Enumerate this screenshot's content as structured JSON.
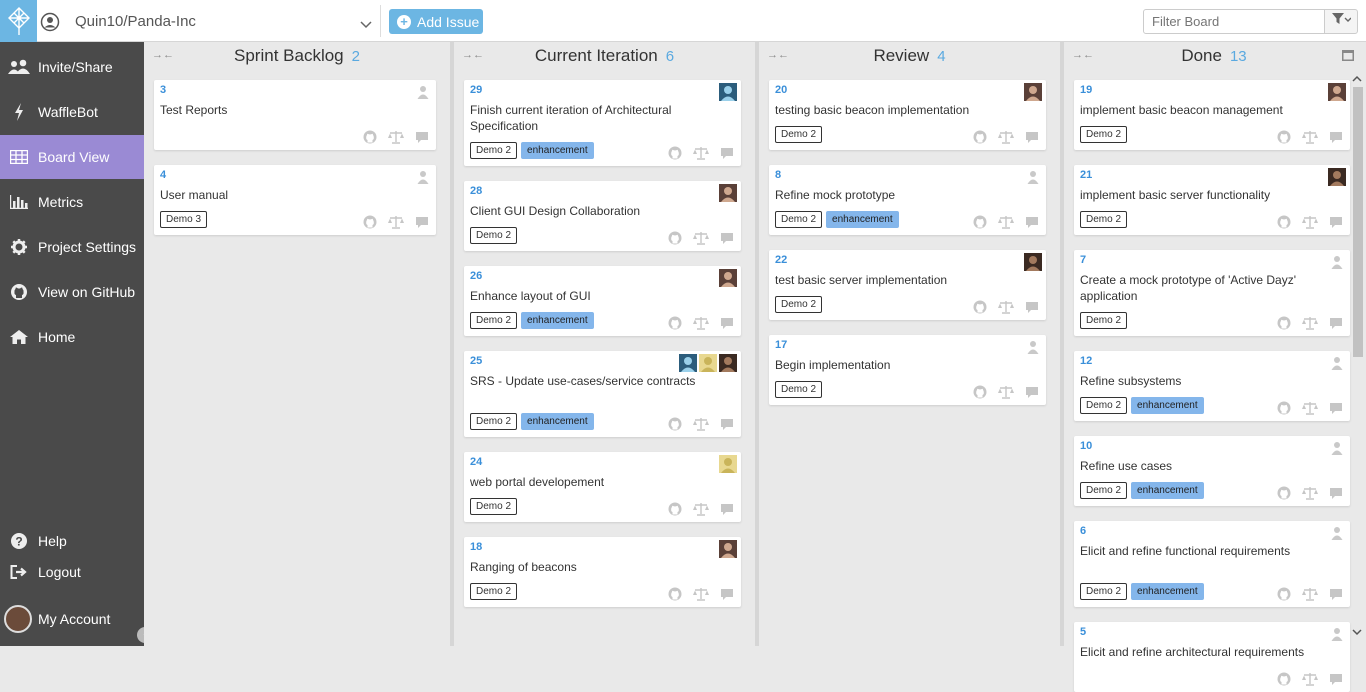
{
  "topbar": {
    "repo": "Quin10/Panda-Inc",
    "add_issue_label": "Add Issue",
    "filter_placeholder": "Filter Board"
  },
  "sidebar": {
    "items": [
      {
        "label": "Invite/Share",
        "icon": "users-icon"
      },
      {
        "label": "WaffleBot",
        "icon": "bolt-icon"
      },
      {
        "label": "Board View",
        "icon": "grid-icon",
        "active": true
      },
      {
        "label": "Metrics",
        "icon": "bar-chart-icon"
      },
      {
        "label": "Project Settings",
        "icon": "gear-icon"
      },
      {
        "label": "View on GitHub",
        "icon": "github-icon"
      },
      {
        "label": "Home",
        "icon": "home-icon"
      }
    ],
    "help_label": "Help",
    "logout_label": "Logout",
    "account_label": "My Account"
  },
  "colors": {
    "accent": "#6cb6e3",
    "active_nav": "#9a8ad4",
    "enhancement": "#84b6eb",
    "sidebar": "#4a4a4a"
  },
  "columns": [
    {
      "name": "Sprint Backlog",
      "count": "2",
      "cards": [
        {
          "num": "3",
          "title": "Test Reports",
          "labels": [],
          "assignees": [
            "blank"
          ]
        },
        {
          "num": "4",
          "title": "User manual",
          "labels": [
            "Demo 3"
          ],
          "assignees": [
            "blank"
          ]
        }
      ]
    },
    {
      "name": "Current Iteration",
      "count": "6",
      "cards": [
        {
          "num": "29",
          "title": "Finish current iteration of Architectural Specification",
          "labels": [
            "Demo 2",
            "enhancement"
          ],
          "assignees": [
            "avatar-a"
          ]
        },
        {
          "num": "28",
          "title": "Client GUI Design Collaboration",
          "labels": [
            "Demo 2"
          ],
          "assignees": [
            "avatar-b"
          ]
        },
        {
          "num": "26",
          "title": "Enhance layout of GUI",
          "labels": [
            "Demo 2",
            "enhancement"
          ],
          "assignees": [
            "avatar-b"
          ]
        },
        {
          "num": "25",
          "title": "SRS - Update use-cases/service contracts",
          "labels": [
            "Demo 2",
            "enhancement"
          ],
          "assignees": [
            "avatar-a",
            "avatar-c",
            "avatar-d"
          ]
        },
        {
          "num": "24",
          "title": "web portal developement",
          "labels": [
            "Demo 2"
          ],
          "assignees": [
            "avatar-c"
          ]
        },
        {
          "num": "18",
          "title": "Ranging of beacons",
          "labels": [
            "Demo 2"
          ],
          "assignees": [
            "avatar-b"
          ]
        }
      ]
    },
    {
      "name": "Review",
      "count": "4",
      "cards": [
        {
          "num": "20",
          "title": "testing basic beacon implementation",
          "labels": [
            "Demo 2"
          ],
          "assignees": [
            "avatar-b"
          ]
        },
        {
          "num": "8",
          "title": "Refine mock prototype",
          "labels": [
            "Demo 2",
            "enhancement"
          ],
          "assignees": [
            "blank"
          ]
        },
        {
          "num": "22",
          "title": "test basic server implementation",
          "labels": [
            "Demo 2"
          ],
          "assignees": [
            "avatar-d"
          ]
        },
        {
          "num": "17",
          "title": "Begin implementation",
          "labels": [
            "Demo 2"
          ],
          "assignees": [
            "blank"
          ]
        }
      ]
    },
    {
      "name": "Done",
      "count": "13",
      "cards": [
        {
          "num": "19",
          "title": "implement basic beacon management",
          "labels": [
            "Demo 2"
          ],
          "assignees": [
            "avatar-b"
          ]
        },
        {
          "num": "21",
          "title": "implement basic server functionality",
          "labels": [
            "Demo 2"
          ],
          "assignees": [
            "avatar-d"
          ]
        },
        {
          "num": "7",
          "title": "Create a mock prototype of 'Active Dayz' application",
          "labels": [
            "Demo 2"
          ],
          "assignees": [
            "blank"
          ]
        },
        {
          "num": "12",
          "title": "Refine subsystems",
          "labels": [
            "Demo 2",
            "enhancement"
          ],
          "assignees": [
            "blank"
          ]
        },
        {
          "num": "10",
          "title": "Refine use cases",
          "labels": [
            "Demo 2",
            "enhancement"
          ],
          "assignees": [
            "blank"
          ]
        },
        {
          "num": "6",
          "title": "Elicit and refine functional requirements",
          "labels": [
            "Demo 2",
            "enhancement"
          ],
          "assignees": [
            "blank"
          ]
        },
        {
          "num": "5",
          "title": "Elicit and refine architectural requirements",
          "labels": [],
          "assignees": [
            "blank"
          ]
        }
      ]
    }
  ]
}
